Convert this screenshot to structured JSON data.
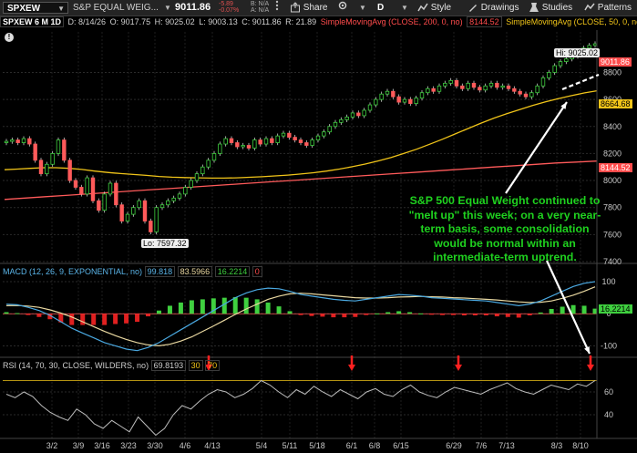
{
  "toolbar": {
    "symbol": "SPXEW",
    "description": "S&P EQUAL WEIG...",
    "last": "9011.86",
    "change": "-5.89",
    "change_pct": "-0.07%",
    "bid": "B: N/A",
    "ask": "A: N/A",
    "share": "Share",
    "drawings": "Drawings",
    "studies": "Studies",
    "patterns": "Patterns",
    "d_label": "D",
    "colors": {
      "down": "#e05050",
      "toolbar": "#242424"
    }
  },
  "chart_header": {
    "symbol_period": "SPXEW 6 M 1D",
    "date": "D: 8/14/26",
    "open": "O: 9017.75",
    "high": "H: 9025.02",
    "low": "L: 9003.13",
    "close": "C: 9011.86",
    "range": "R: 21.89",
    "sma200_label": "SimpleMovingAvg (CLOSE, 200, 0, no)",
    "sma200_value": "8144.52",
    "sma50_label": "SimpleMovingAvg (CLOSE, 50, 0, no)",
    "sma50_value": "8664.68"
  },
  "price_panel": {
    "hi_label": "Hi: 9025.02",
    "lo_label": "Lo: 7597.32",
    "last_tag": "9011.86",
    "sma50_tag": "8664.68",
    "sma200_tag": "8144.52",
    "y_ticks": [
      "8800",
      "8600",
      "8400",
      "8200",
      "8000",
      "7800",
      "7600",
      "7400"
    ]
  },
  "macd_panel": {
    "label": "MACD (12, 26, 9, EXPONENTIAL, no)",
    "value": "99.818",
    "avg": "83.5966",
    "diff": "16.2214",
    "zero": "0",
    "tag": "16.2214",
    "y_ticks": [
      "100",
      "0",
      "-100"
    ]
  },
  "rsi_panel": {
    "label": "RSI (14, 70, 30, CLOSE, WILDERS, no)",
    "value": "69.8193",
    "ob": "30",
    "os": "70",
    "y_ticks": [
      "60",
      "40"
    ]
  },
  "annotation": "S&P 500 Equal Weight continued to \"melt up\" this week; on a very near-term basis, some consolidation would be normal within an intermediate-term uptrend.",
  "x_axis": [
    "3/2",
    "3/9",
    "3/16",
    "3/23",
    "3/30",
    "4/6",
    "4/13",
    "5/4",
    "5/11",
    "5/18",
    "6/1",
    "6/8",
    "6/15",
    "6/29",
    "7/6",
    "7/13",
    "8/3",
    "8/10"
  ],
  "chart_data": [
    {
      "type": "candlestick",
      "ylim": [
        7400,
        9100
      ],
      "y_ticks": [
        8800,
        8600,
        8400,
        8200,
        8000,
        7800,
        7600,
        7400
      ],
      "close": [
        8290,
        8300,
        8280,
        8310,
        8270,
        8150,
        8050,
        8120,
        8200,
        8300,
        8150,
        8000,
        7950,
        7900,
        8020,
        7850,
        7780,
        7900,
        7980,
        7820,
        7700,
        7750,
        7800,
        7850,
        7700,
        7620,
        7800,
        7820,
        7850,
        7870,
        7900,
        7950,
        8000,
        8050,
        8100,
        8150,
        8200,
        8270,
        8310,
        8280,
        8250,
        8260,
        8240,
        8300,
        8270,
        8310,
        8280,
        8330,
        8350,
        8320,
        8300,
        8280,
        8260,
        8300,
        8330,
        8360,
        8400,
        8430,
        8450,
        8470,
        8500,
        8480,
        8520,
        8560,
        8600,
        8640,
        8660,
        8620,
        8580,
        8600,
        8570,
        8610,
        8650,
        8680,
        8660,
        8700,
        8720,
        8740,
        8700,
        8680,
        8720,
        8690,
        8670,
        8700,
        8720,
        8690,
        8700,
        8680,
        8660,
        8640,
        8620,
        8650,
        8700,
        8760,
        8800,
        8850,
        8880,
        8900,
        8920,
        8950,
        8980,
        9000,
        9012
      ],
      "sma50": [
        8080,
        8085,
        8090,
        8095,
        8095,
        8090,
        8082,
        8070,
        8060,
        8052,
        8045,
        8038,
        8030,
        8025,
        8022,
        8020,
        8018,
        8018,
        8020,
        8024,
        8028,
        8034,
        8040,
        8048,
        8058,
        8070,
        8085,
        8102,
        8122,
        8145,
        8170,
        8200,
        8232,
        8268,
        8305,
        8345,
        8385,
        8425,
        8462,
        8495,
        8525,
        8555,
        8582,
        8606,
        8628,
        8648,
        8664
      ],
      "sma200": [
        7860,
        7870,
        7880,
        7890,
        7900,
        7910,
        7920,
        7930,
        7940,
        7950,
        7960,
        7970,
        7980,
        7990,
        8000,
        8010,
        8020,
        8030,
        8040,
        8050,
        8060,
        8070,
        8080,
        8090,
        8100,
        8110,
        8120,
        8130,
        8137,
        8144
      ],
      "hi": 9025.02,
      "lo": 7597.32
    },
    {
      "type": "bar",
      "name": "MACD (12, 26, 9, EXPONENTIAL, no)",
      "ylim": [
        -130,
        120
      ],
      "y_ticks": [
        100,
        0,
        -100
      ],
      "macd": [
        30,
        28,
        20,
        10,
        -5,
        -25,
        -45,
        -60,
        -75,
        -90,
        -100,
        -110,
        -115,
        -105,
        -90,
        -70,
        -50,
        -30,
        -10,
        10,
        30,
        50,
        65,
        75,
        80,
        78,
        70,
        60,
        55,
        50,
        45,
        42,
        40,
        45,
        50,
        55,
        60,
        58,
        55,
        50,
        48,
        46,
        44,
        42,
        40,
        35,
        30,
        25,
        30,
        40,
        55,
        70,
        85,
        95,
        100
      ],
      "signal": [
        25,
        26,
        24,
        20,
        12,
        2,
        -10,
        -25,
        -40,
        -55,
        -68,
        -80,
        -90,
        -97,
        -100,
        -95,
        -85,
        -72,
        -55,
        -38,
        -20,
        -2,
        15,
        30,
        45,
        55,
        62,
        64,
        62,
        59,
        56,
        53,
        50,
        49,
        49,
        50,
        52,
        53,
        54,
        53,
        52,
        50,
        49,
        47,
        45,
        43,
        40,
        37,
        35,
        36,
        40,
        48,
        58,
        70,
        84
      ],
      "hist": [
        5,
        2,
        -4,
        -10,
        -17,
        -27,
        -35,
        -35,
        -35,
        -35,
        -32,
        -30,
        -25,
        -8,
        10,
        25,
        35,
        42,
        45,
        48,
        50,
        52,
        50,
        45,
        35,
        23,
        8,
        -4,
        -7,
        -9,
        -11,
        -11,
        -10,
        -4,
        1,
        5,
        8,
        5,
        1,
        -3,
        -4,
        -4,
        -5,
        -5,
        -5,
        -8,
        -10,
        -12,
        -5,
        4,
        15,
        22,
        27,
        25,
        16
      ]
    },
    {
      "type": "line",
      "name": "RSI (14, 70, 30, CLOSE, WILDERS, no)",
      "ylim": [
        20,
        80
      ],
      "y_ticks": [
        60,
        40
      ],
      "values": [
        58,
        55,
        60,
        56,
        48,
        42,
        38,
        35,
        45,
        40,
        32,
        28,
        35,
        30,
        25,
        38,
        30,
        22,
        28,
        40,
        48,
        45,
        52,
        58,
        62,
        60,
        55,
        58,
        63,
        70,
        66,
        60,
        55,
        62,
        58,
        65,
        60,
        56,
        62,
        58,
        54,
        60,
        63,
        58,
        56,
        62,
        66,
        60,
        57,
        55,
        60,
        64,
        62,
        60,
        58,
        62,
        65,
        68,
        63,
        60,
        58,
        62,
        66,
        64,
        62,
        67,
        65,
        70
      ],
      "overbought": 70,
      "oversold": 30
    }
  ]
}
